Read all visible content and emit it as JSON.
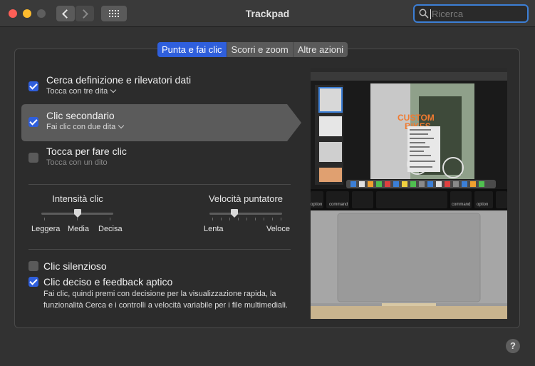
{
  "window": {
    "title": "Trackpad"
  },
  "search": {
    "placeholder": "Ricerca"
  },
  "tabs": [
    {
      "label": "Punta e fai clic",
      "active": true
    },
    {
      "label": "Scorri e zoom",
      "active": false
    },
    {
      "label": "Altre azioni",
      "active": false
    }
  ],
  "options": {
    "lookup": {
      "title": "Cerca definizione e rilevatori dati",
      "subtitle": "Tocca con tre dita",
      "checked": true
    },
    "secondary_click": {
      "title": "Clic secondario",
      "subtitle": "Fai clic con due dita",
      "checked": true
    },
    "tap_to_click": {
      "title": "Tocca per fare clic",
      "subtitle": "Tocca con un dito",
      "checked": false
    }
  },
  "click_intensity": {
    "label": "Intensità clic",
    "ticks": [
      "Leggera",
      "Media",
      "Decisa"
    ],
    "value_index": 1
  },
  "pointer_speed": {
    "label": "Velocità puntatore",
    "min_label": "Lenta",
    "max_label": "Veloce",
    "value_fraction": 0.34
  },
  "silent_click": {
    "label": "Clic silenzioso",
    "checked": false
  },
  "force_click": {
    "label": "Clic deciso e feedback aptico",
    "checked": true,
    "description": "Fai clic, quindi premi con decisione per la visualizzazione rapida, la funzionalità Cerca e i controlli a velocità variabile per i file multimediali."
  },
  "preview": {
    "keys": {
      "option_left": "option",
      "command_left": "command",
      "command_right": "command",
      "option_right": "option"
    },
    "poster_text": [
      "CUSTOM",
      "BIKES"
    ]
  },
  "help": {
    "label": "?"
  }
}
